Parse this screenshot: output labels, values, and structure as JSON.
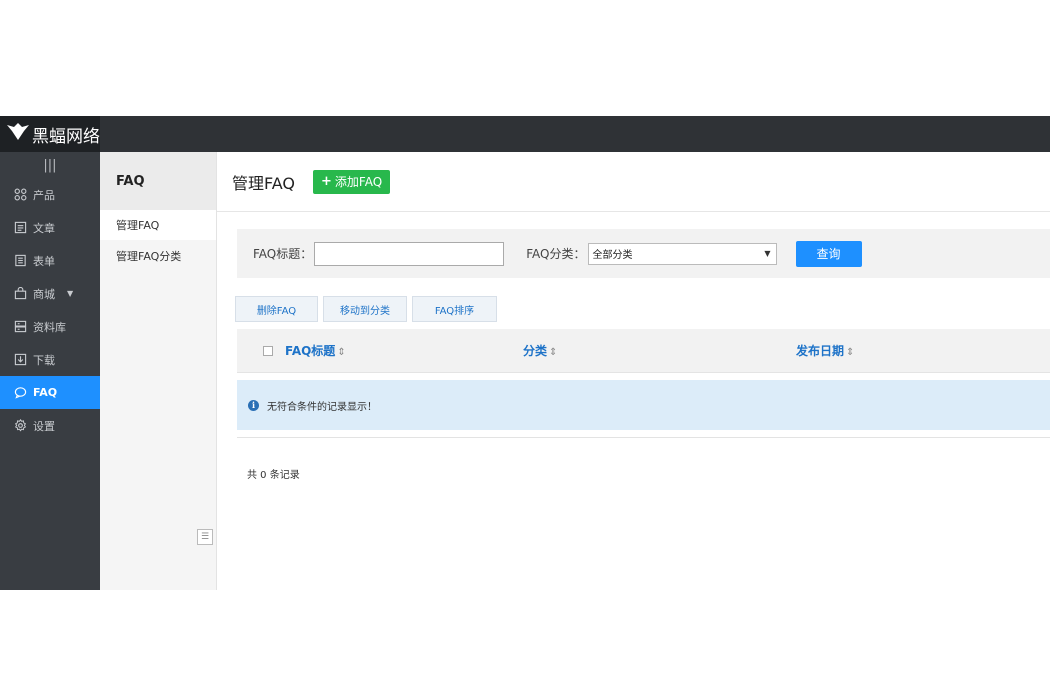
{
  "brand": {
    "name": "黑蝠网络"
  },
  "sidebar": {
    "collapse_icon": "|||",
    "items": [
      {
        "label": "产品",
        "icon": "grid-icon"
      },
      {
        "label": "文章",
        "icon": "doc-icon"
      },
      {
        "label": "表单",
        "icon": "form-icon"
      },
      {
        "label": "商城",
        "icon": "bag-icon",
        "caret": "▼"
      },
      {
        "label": "资料库",
        "icon": "database-icon"
      },
      {
        "label": "下载",
        "icon": "download-icon"
      },
      {
        "label": "FAQ",
        "icon": "chat-icon",
        "active": true
      },
      {
        "label": "设置",
        "icon": "gear-icon"
      }
    ]
  },
  "subnav": {
    "title": "FAQ",
    "items": [
      {
        "label": "管理FAQ",
        "active": true
      },
      {
        "label": "管理FAQ分类"
      }
    ],
    "toggle_icon": "☰"
  },
  "main": {
    "title": "管理FAQ",
    "add_button": "添加FAQ",
    "add_plus": "+",
    "search": {
      "title_label": "FAQ标题：",
      "title_value": "",
      "category_label": "FAQ分类：",
      "category_selected": "全部分类",
      "query_button": "查询"
    },
    "actions": [
      "删除FAQ",
      "移动到分类",
      "FAQ排序"
    ],
    "table": {
      "columns": [
        "FAQ标题",
        "分类",
        "发布日期"
      ],
      "sort_glyph": "⇕",
      "empty_message": "无符合条件的记录显示！",
      "info_glyph": "i"
    },
    "total_text": "共 0 条记录"
  },
  "colors": {
    "topbar": "#2f3236",
    "sidebar": "#393d42",
    "accent": "#1e90ff",
    "success": "#28b84c",
    "link": "#1e73c8"
  }
}
